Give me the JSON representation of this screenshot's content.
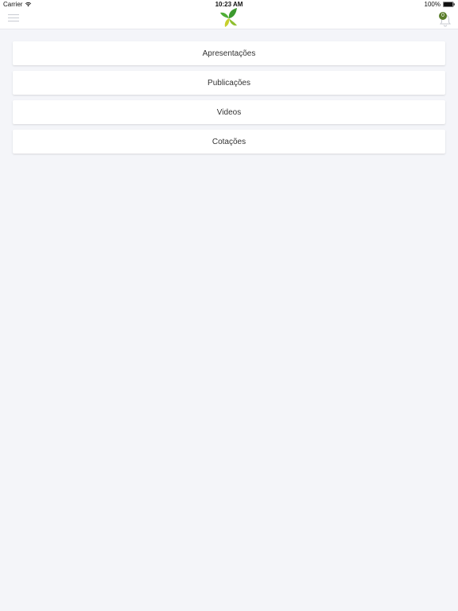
{
  "status_bar": {
    "carrier": "Carrier",
    "time": "10:23 AM",
    "battery": "100%"
  },
  "nav": {
    "notification_count": "0",
    "colors": {
      "badge": "#5a7d2a",
      "logo_green": "#3c9a2e",
      "logo_yellow": "#c7cf2d"
    }
  },
  "menu": {
    "items": [
      {
        "label": "Apresentações"
      },
      {
        "label": "Publicações"
      },
      {
        "label": "Videos"
      },
      {
        "label": "Cotações"
      }
    ]
  }
}
